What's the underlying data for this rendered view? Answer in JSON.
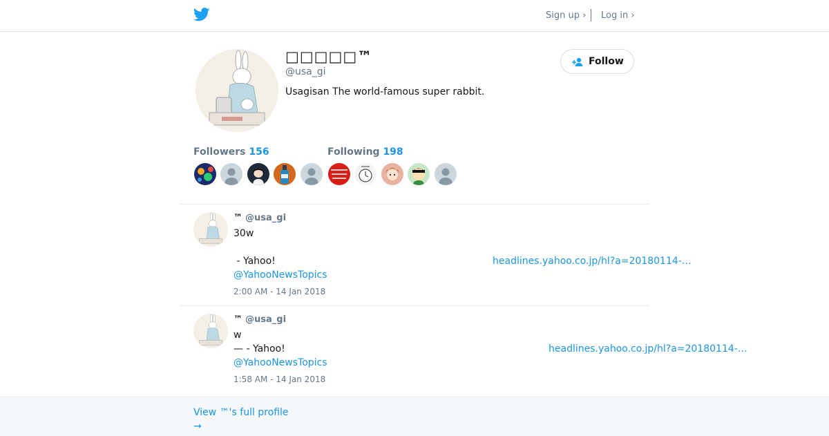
{
  "header": {
    "signup": "Sign up ›",
    "login": "Log in ›"
  },
  "profile": {
    "display_name": "□□□□□™",
    "handle": "@usa_gi",
    "bio": "Usagisan The world-famous super rabbit.",
    "follow_label": "Follow"
  },
  "stats": {
    "followers_label": "Followers",
    "followers_count": "156",
    "following_label": "Following",
    "following_count": "198"
  },
  "tweets": [
    {
      "name": "™",
      "handle": "@usa_gi",
      "line1": "30w",
      "line2": " - Yahoo!",
      "link": "headlines.yahoo.co.jp/hl?a=20180114-…",
      "mention": "@YahooNewsTopics",
      "time": "2:00 AM - 14 Jan 2018"
    },
    {
      "name": "™",
      "handle": "@usa_gi",
      "line1": "w",
      "line2": "— - Yahoo!",
      "link": "headlines.yahoo.co.jp/hl?a=20180114-…",
      "mention": "@YahooNewsTopics",
      "time": "1:58 AM - 14 Jan 2018"
    }
  ],
  "footer": {
    "line1": "View ™'s full profile",
    "arrow": "→"
  },
  "colors": {
    "link": "#1b95e0",
    "muted": "#657786",
    "text": "#14171a",
    "brand": "#1da1f2"
  }
}
